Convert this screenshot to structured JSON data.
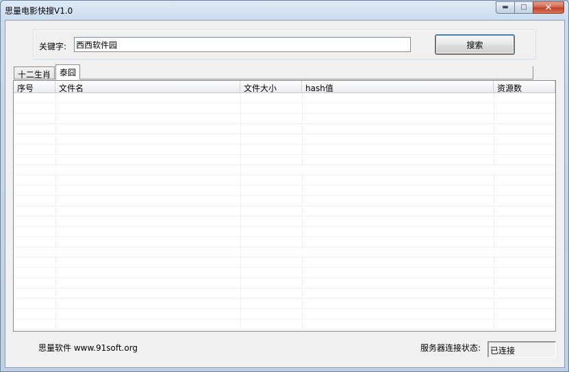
{
  "window": {
    "title": "思量电影快搜V1.0",
    "minimize_glyph": "▬",
    "maximize_glyph": "□",
    "close_glyph": "✕"
  },
  "search": {
    "label": "关键字:",
    "value": "西西软件园",
    "button_label": "搜索"
  },
  "tabs": [
    {
      "label": "十二生肖",
      "active": false
    },
    {
      "label": "泰囧",
      "active": true
    }
  ],
  "table": {
    "columns": [
      "序号",
      "文件名",
      "文件大小",
      "hash值",
      "资源数"
    ],
    "rows": []
  },
  "footer": {
    "company": "思量软件 www.91soft.org",
    "status_label": "服务器连接状态:",
    "status_value": "已连接"
  },
  "colors": {
    "accent": "#3c7fb1",
    "close_button": "#c04126"
  },
  "icons": {
    "minimize": "minimize-icon",
    "maximize": "maximize-icon",
    "close": "close-icon"
  }
}
